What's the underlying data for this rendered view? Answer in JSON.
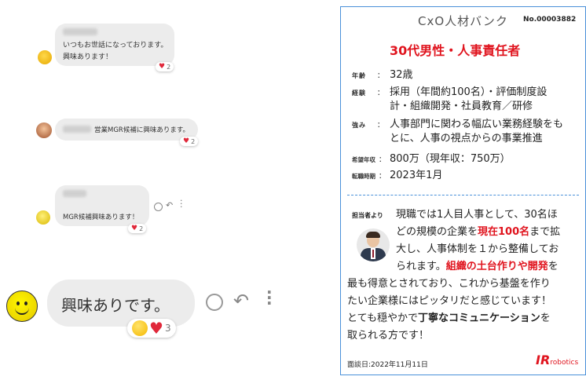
{
  "chat": {
    "messages": [
      {
        "text_line1": "いつもお世話になっております。",
        "text_line2": "興味あります！",
        "reaction_count": "2"
      },
      {
        "text": "営業MGR候補に興味あります。",
        "reaction_count": "2"
      },
      {
        "text": "MGR候補興味あります！",
        "reaction_count": "2"
      },
      {
        "text": "興味ありです。",
        "reaction_count": "3"
      }
    ]
  },
  "card": {
    "brand": "CxO人材バンク",
    "number": "No.00003882",
    "title": "30代男性・人事責任者",
    "rows": [
      {
        "label": "年齢",
        "value": "32歳"
      },
      {
        "label": "経験",
        "value_line1": "採用（年間約100名）・評価制度設",
        "value_line2": "計・組織開発・社員教育／研修"
      },
      {
        "label": "強み",
        "value_line1": "人事部門に関わる幅広い業務経験をも",
        "value_line2": "とに、人事の視点からの事業推進"
      },
      {
        "label": "希望年収",
        "value": "800万（現年収：750万）"
      },
      {
        "label": "転職時期",
        "value": "2023年1月"
      }
    ],
    "recommender_label": "担当者より",
    "comment": {
      "l1": "現職では1人目人事として、30名ほ",
      "l2a": "どの規模の企業を",
      "l2b": "現在100名",
      "l2c": "まで拡",
      "l3": "大し、人事体制を１から整備してお",
      "l4a": "られます。",
      "l4b": "組織の土台作りや開発",
      "l4c": "を",
      "l5": "最も得意とされており、これから基盤を作り",
      "l6": "たい企業様にはピッタリだと感じています！",
      "l7a": "とても穏やかで",
      "l7b": "丁寧なコミュニケーション",
      "l7c": "を",
      "l8": "取られる方です！"
    },
    "interview_date": "面談日:2022年11月11日",
    "logo_ir": "IR",
    "logo_robotics": "robotics"
  },
  "colors": {
    "accent_red": "#e0141e",
    "card_border": "#4a90d9",
    "bubble": "#ececec"
  }
}
